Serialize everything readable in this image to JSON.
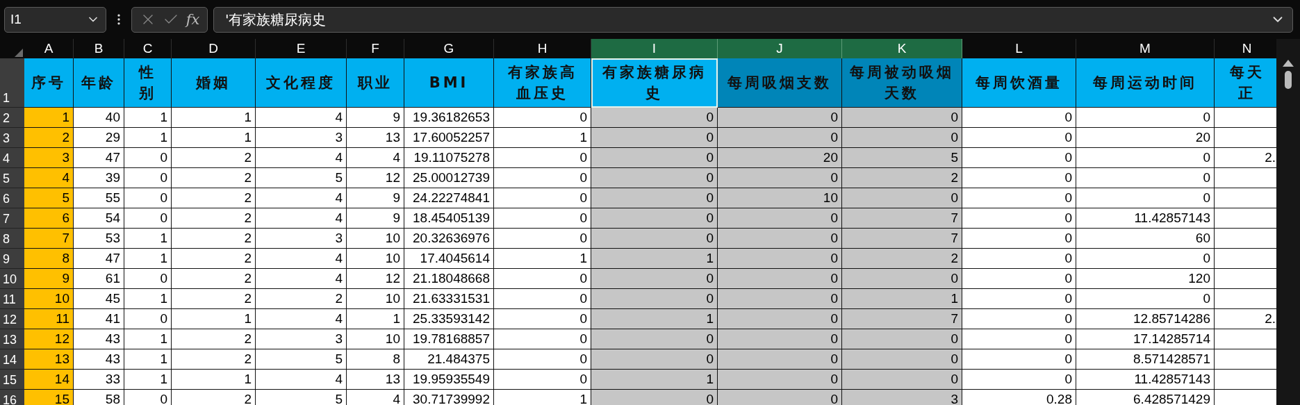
{
  "formula_bar": {
    "name_box": "I1",
    "function_label": "fx",
    "formula": "'有家族糖尿病史"
  },
  "columns": [
    {
      "letter": "A",
      "heading": "序号",
      "selected": false,
      "active": false
    },
    {
      "letter": "B",
      "heading": "年龄",
      "selected": false,
      "active": false
    },
    {
      "letter": "C",
      "heading": "性别",
      "selected": false,
      "active": false
    },
    {
      "letter": "D",
      "heading": "婚姻",
      "selected": false,
      "active": false
    },
    {
      "letter": "E",
      "heading": "文化程度",
      "selected": false,
      "active": false
    },
    {
      "letter": "F",
      "heading": "职业",
      "selected": false,
      "active": false
    },
    {
      "letter": "G",
      "heading": "BMI",
      "selected": false,
      "active": false
    },
    {
      "letter": "H",
      "heading": "有家族高血压史",
      "selected": false,
      "active": false
    },
    {
      "letter": "I",
      "heading": "有家族糖尿病史",
      "selected": true,
      "active": true
    },
    {
      "letter": "J",
      "heading": "每周吸烟支数",
      "selected": true,
      "active": false
    },
    {
      "letter": "K",
      "heading": "每周被动吸烟天数",
      "selected": true,
      "active": false
    },
    {
      "letter": "L",
      "heading": "每周饮酒量",
      "selected": false,
      "active": false
    },
    {
      "letter": "M",
      "heading": "每周运动时间",
      "selected": false,
      "active": false
    },
    {
      "letter": "N",
      "heading": "每天正",
      "selected": false,
      "active": false
    }
  ],
  "header_row_number": "1",
  "rows": [
    {
      "number": "2",
      "cells": [
        "1",
        "40",
        "1",
        "1",
        "4",
        "9",
        "19.36182653",
        "0",
        "0",
        "0",
        "0",
        "0",
        "0",
        ""
      ]
    },
    {
      "number": "3",
      "cells": [
        "2",
        "29",
        "1",
        "1",
        "3",
        "13",
        "17.60052257",
        "1",
        "0",
        "0",
        "0",
        "0",
        "20",
        ""
      ]
    },
    {
      "number": "4",
      "cells": [
        "3",
        "47",
        "0",
        "2",
        "4",
        "4",
        "19.11075278",
        "0",
        "0",
        "20",
        "5",
        "0",
        "0",
        "2."
      ]
    },
    {
      "number": "5",
      "cells": [
        "4",
        "39",
        "0",
        "2",
        "5",
        "12",
        "25.00012739",
        "0",
        "0",
        "0",
        "2",
        "0",
        "0",
        ""
      ]
    },
    {
      "number": "6",
      "cells": [
        "5",
        "55",
        "0",
        "2",
        "4",
        "9",
        "24.22274841",
        "0",
        "0",
        "10",
        "0",
        "0",
        "0",
        ""
      ]
    },
    {
      "number": "7",
      "cells": [
        "6",
        "54",
        "0",
        "2",
        "4",
        "9",
        "18.45405139",
        "0",
        "0",
        "0",
        "7",
        "0",
        "11.42857143",
        ""
      ]
    },
    {
      "number": "8",
      "cells": [
        "7",
        "53",
        "1",
        "2",
        "3",
        "10",
        "20.32636976",
        "0",
        "0",
        "0",
        "7",
        "0",
        "60",
        ""
      ]
    },
    {
      "number": "9",
      "cells": [
        "8",
        "47",
        "1",
        "2",
        "4",
        "10",
        "17.4045614",
        "1",
        "1",
        "0",
        "2",
        "0",
        "0",
        ""
      ]
    },
    {
      "number": "10",
      "cells": [
        "9",
        "61",
        "0",
        "2",
        "4",
        "12",
        "21.18048668",
        "0",
        "0",
        "0",
        "0",
        "0",
        "120",
        ""
      ]
    },
    {
      "number": "11",
      "cells": [
        "10",
        "45",
        "1",
        "2",
        "2",
        "10",
        "21.63331531",
        "0",
        "0",
        "0",
        "1",
        "0",
        "0",
        ""
      ]
    },
    {
      "number": "12",
      "cells": [
        "11",
        "41",
        "0",
        "1",
        "4",
        "1",
        "25.33593142",
        "0",
        "1",
        "0",
        "7",
        "0",
        "12.85714286",
        "2."
      ]
    },
    {
      "number": "13",
      "cells": [
        "12",
        "43",
        "1",
        "2",
        "3",
        "10",
        "19.78168857",
        "0",
        "0",
        "0",
        "0",
        "0",
        "17.14285714",
        ""
      ]
    },
    {
      "number": "14",
      "cells": [
        "13",
        "43",
        "1",
        "2",
        "5",
        "8",
        "21.484375",
        "0",
        "0",
        "0",
        "0",
        "0",
        "8.571428571",
        ""
      ]
    },
    {
      "number": "15",
      "cells": [
        "14",
        "33",
        "1",
        "1",
        "4",
        "13",
        "19.95935549",
        "0",
        "1",
        "0",
        "0",
        "0",
        "11.42857143",
        ""
      ]
    },
    {
      "number": "16",
      "cells": [
        "15",
        "58",
        "0",
        "2",
        "5",
        "4",
        "30.71739992",
        "1",
        "0",
        "0",
        "3",
        "0.28",
        "6.428571429",
        ""
      ]
    }
  ]
}
